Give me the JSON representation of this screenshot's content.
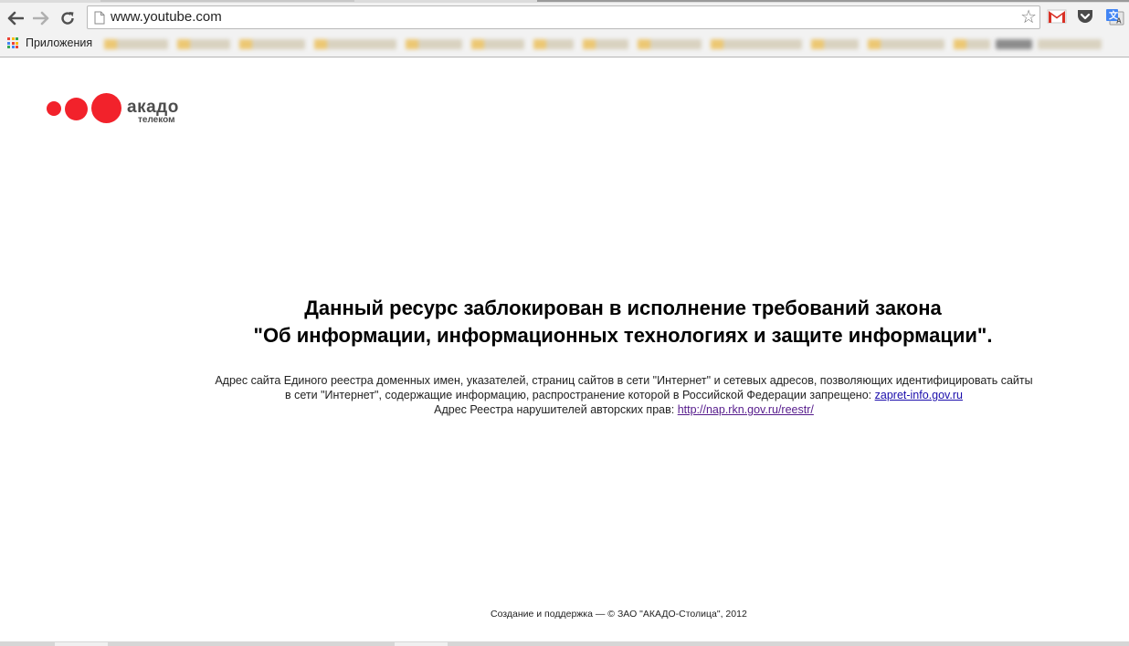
{
  "browser": {
    "url": "www.youtube.com",
    "bookmarks_bar": {
      "apps_label": "Приложения"
    },
    "icons": [
      "back-icon",
      "forward-icon",
      "reload-icon",
      "page-icon",
      "star-icon",
      "gmail-icon",
      "pocket-icon",
      "translate-icon",
      "apps-grid-icon"
    ]
  },
  "logo": {
    "brand": "акадо",
    "sub": "телеком",
    "color": "#f2222b"
  },
  "main": {
    "heading_line1": "Данный ресурс заблокирован в исполнение требований закона",
    "heading_line2": "\"Об информации, информационных технологиях и защите информации\".",
    "info_line1": "Адрес сайта Единого реестра доменных имен, указателей, страниц сайтов в сети \"Интернет\" и сетевых адресов, позволяющих идентифицировать сайты",
    "info_line2_text": "в сети \"Интернет\", содержащие информацию, распространение которой в Российской Федерации запрещено:",
    "info_line2_link": "zapret-info.gov.ru",
    "info_line3_text": "Адрес Реестра нарушителей авторских прав:",
    "info_line3_link": "http://nap.rkn.gov.ru/reestr/"
  },
  "footer": {
    "text": "Создание и поддержка — © ЗАО \"АКАДО-Столица\", 2012"
  }
}
